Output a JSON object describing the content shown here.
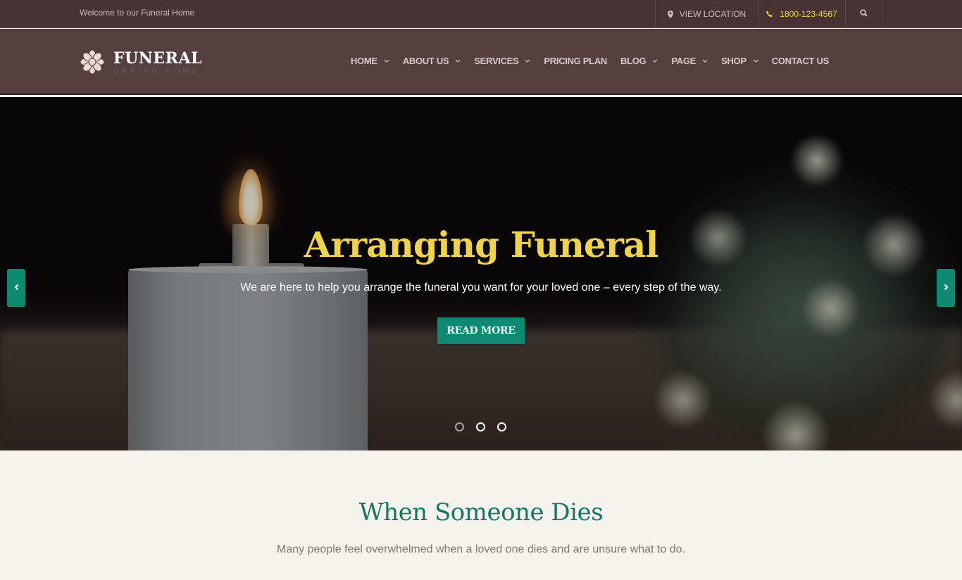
{
  "topbar": {
    "welcome": "Welcome to our Funeral Home",
    "location_label": "VIEW LOCATION",
    "location_icon": "map-marker-icon",
    "phone": "1800-123-4567",
    "phone_icon": "phone-icon",
    "search_icon": "search-icon"
  },
  "header": {
    "logo_name": "FUNERAL",
    "logo_tagline": "CARING HOME",
    "logo_icon": "lotus-flower-icon",
    "nav": [
      {
        "label": "HOME",
        "has_dropdown": true
      },
      {
        "label": "ABOUT US",
        "has_dropdown": true
      },
      {
        "label": "SERVICES",
        "has_dropdown": true
      },
      {
        "label": "PRICING PLAN",
        "has_dropdown": false
      },
      {
        "label": "BLOG",
        "has_dropdown": true
      },
      {
        "label": "PAGE",
        "has_dropdown": true
      },
      {
        "label": "SHOP",
        "has_dropdown": true
      },
      {
        "label": "CONTACT US",
        "has_dropdown": false
      }
    ]
  },
  "hero": {
    "title": "Arranging Funeral",
    "subtitle": "We are here to help you arrange the funeral you want for your loved one – every step of the way.",
    "cta_label": "READ MORE",
    "prev_icon": "chevron-left-icon",
    "next_icon": "chevron-right-icon",
    "slides_total": 3,
    "active_slide": 1
  },
  "section": {
    "heading": "When Someone Dies",
    "text": "Many people feel overwhelmed when a loved one dies and are unsure what to do."
  },
  "colors": {
    "topbar_bg": "#473234",
    "header_bg": "#563f3f",
    "accent_teal": "#0f8a72",
    "accent_yellow": "#efd349",
    "heading_teal": "#137763",
    "section_bg": "#f5f3ec"
  }
}
